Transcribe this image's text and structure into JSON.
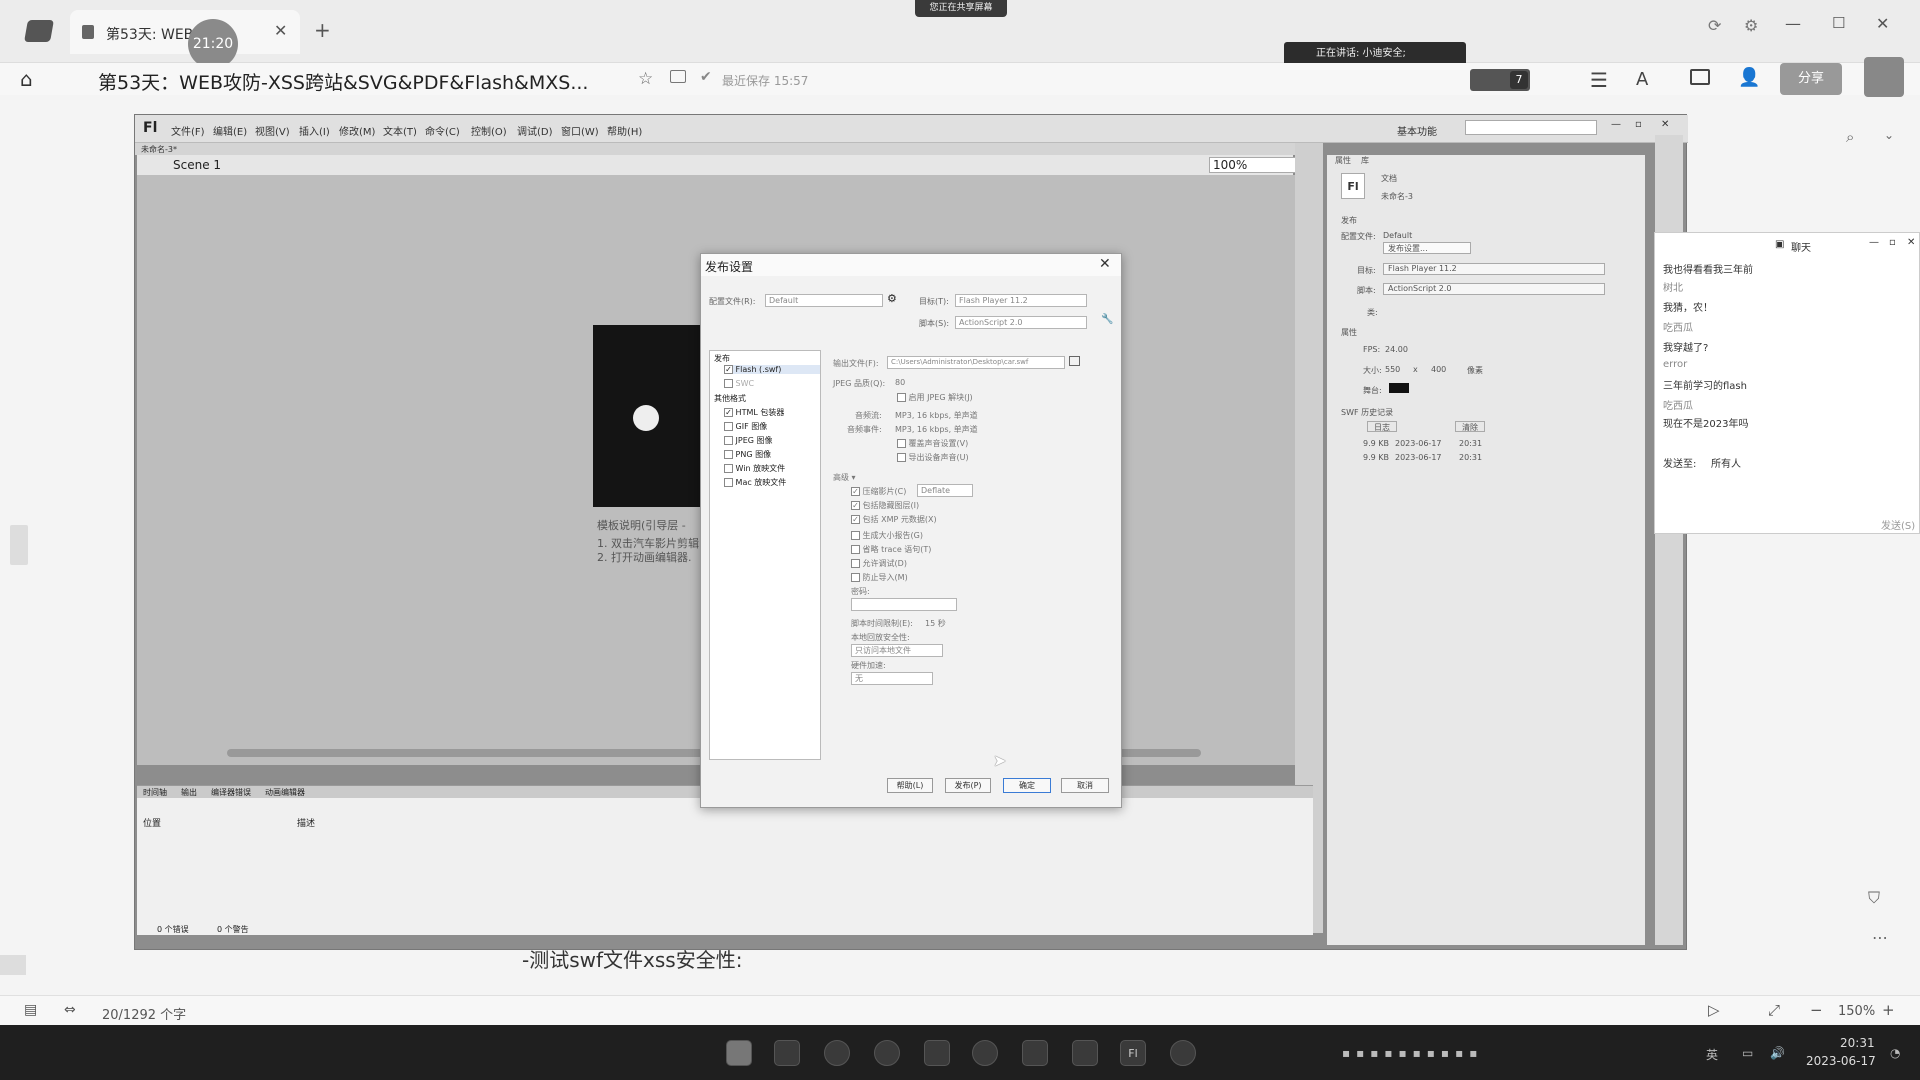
{
  "app": {
    "tab_title": "第53天: WEB...",
    "doc_title": "第53天：WEB攻防-XSS跨站&SVG&PDF&Flash&MXS...",
    "save_status": "最近保存 15:57",
    "share_label": "分享",
    "timer": "21:20",
    "top_banner": "您正在共享屏幕",
    "speaking": "正在讲话: 小迪安全;",
    "notif_count": "7",
    "word_count": "20/1292 个字",
    "zoom": "150%"
  },
  "flash": {
    "logo": "Fl",
    "menu": [
      "文件(F)",
      "编辑(E)",
      "视图(V)",
      "插入(I)",
      "修改(M)",
      "文本(T)",
      "命令(C)",
      "控制(O)",
      "调试(D)",
      "窗口(W)",
      "帮助(H)"
    ],
    "workspace": "基本功能",
    "doc_tab": "未命名-3*",
    "scene": "Scene 1",
    "stage_zoom": "100%",
    "template_hint": "模板说明(引导层 -",
    "hint_1": "1. 双击汽车影片剪辑",
    "hint_2": "2. 打开动画编辑器.",
    "bottom_tabs": [
      "时间轴",
      "输出",
      "编译器错误",
      "动画编辑器"
    ],
    "col_location": "位置",
    "col_desc": "描述",
    "status_errors": "0 个错误",
    "status_warnings": "0 个警告"
  },
  "properties": {
    "tabs": [
      "属性",
      "库"
    ],
    "doc_label": "文档",
    "doc_name": "未命名-3",
    "publish_header": "发布",
    "profile_label": "配置文件:",
    "profile_value": "Default",
    "publish_settings_btn": "发布设置...",
    "target_label": "目标:",
    "target_value": "Flash Player 11.2",
    "script_label": "脚本:",
    "script_value": "ActionScript 2.0",
    "class_label": "类:",
    "props_header": "属性",
    "fps_label": "FPS:",
    "fps_value": "24.00",
    "size_label": "大小:",
    "size_w": "550",
    "size_x": "x",
    "size_h": "400",
    "size_unit": "像素",
    "stage_label": "舞台:",
    "history_header": "SWF 历史记录",
    "log_btn": "日志",
    "clear_btn": "清除",
    "history": [
      {
        "size": "9.9 KB",
        "date": "2023-06-17",
        "time": "20:31"
      },
      {
        "size": "9.9 KB",
        "date": "2023-06-17",
        "time": "20:31"
      }
    ]
  },
  "dialog": {
    "title": "发布设置",
    "profile_label": "配置文件(R):",
    "profile_value": "Default",
    "target_label": "目标(T):",
    "target_value": "Flash Player 11.2",
    "script_label": "脚本(S):",
    "script_value": "ActionScript 2.0",
    "publish_group": "发布",
    "flash_swf": "Flash (.swf)",
    "swc": "SWC",
    "other_group": "其他格式",
    "formats": [
      "HTML 包装器",
      "GIF 图像",
      "JPEG 图像",
      "PNG 图像",
      "Win 放映文件",
      "Mac 放映文件"
    ],
    "output_label": "输出文件(F):",
    "output_value": "C:\\Users\\Administrator\\Desktop\\car.swf",
    "jpeg_label": "JPEG 品质(Q):",
    "jpeg_value": "80",
    "jpeg_deblock": "启用 JPEG 解块(J)",
    "audio_stream_label": "音频流:",
    "audio_stream_value": "MP3, 16 kbps, 单声道",
    "audio_event_label": "音频事件:",
    "audio_event_value": "MP3, 16 kbps, 单声道",
    "override_sound": "覆盖声音设置(V)",
    "export_device_sound": "导出设备声音(U)",
    "advanced": "高级",
    "compress_movie": "压缩影片(C)",
    "compress_value": "Deflate",
    "include_hidden": "包括隐藏图层(I)",
    "include_xmp": "包括 XMP 元数据(X)",
    "size_report": "生成大小报告(G)",
    "omit_trace": "省略 trace 语句(T)",
    "allow_debug": "允许调试(D)",
    "protect_import": "防止导入(M)",
    "password_label": "密码:",
    "script_time_label": "脚本时间限制(E):",
    "script_time_value": "15 秒",
    "local_security_label": "本地回放安全性:",
    "local_security_value": "只访问本地文件",
    "hw_accel_label": "硬件加速:",
    "hw_accel_value": "无",
    "btn_help": "帮助(L)",
    "btn_publish": "发布(P)",
    "btn_ok": "确定",
    "btn_cancel": "取消"
  },
  "chat": {
    "title": "聊天",
    "messages": [
      "我也得看看我三年前",
      "树北",
      "我猜，农！",
      "吃西瓜",
      "我穿越了?",
      "error",
      "三年前学习的flash",
      "吃西瓜",
      "现在不是2023年吗"
    ],
    "send_to_label": "发送至:",
    "send_to_value": "所有人",
    "send_btn": "发送(S)"
  },
  "doc_behind": {
    "line": "-测试swf文件xss安全性:"
  },
  "taskbar": {
    "ime": "英",
    "time": "20:31",
    "date": "2023-06-17"
  }
}
